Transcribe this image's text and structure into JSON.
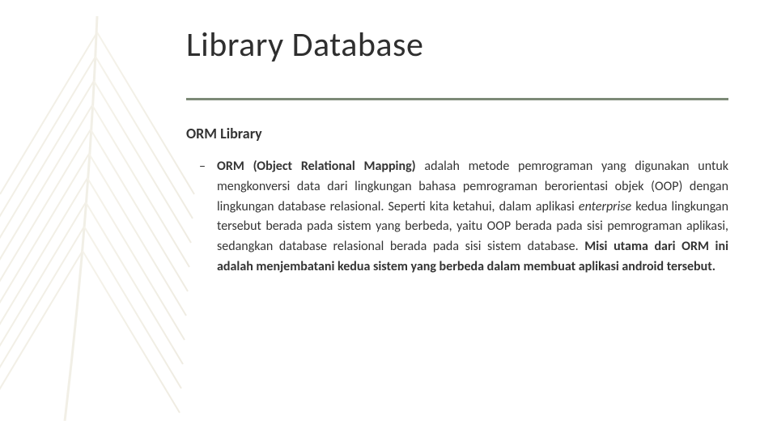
{
  "slide": {
    "title": "Library Database",
    "sub_heading": "ORM Library",
    "bullet": {
      "lead_bold": "ORM (Object Relational Mapping)",
      "text1": " adalah metode pemrograman yang digunakan untuk mengkonversi data dari lingkungan bahasa pemrograman berorientasi objek (OOP) dengan lingkungan database relasional. Seperti kita ketahui, dalam aplikasi ",
      "italic1": "enterprise",
      "text2": " kedua lingkungan tersebut berada pada sistem yang berbeda, yaitu OOP berada pada sisi pemrograman aplikasi, sedangkan database relasional berada pada sisi sistem database. ",
      "tail_bold": "Misi utama dari ORM ini adalah menjembatani kedua sistem yang berbeda dalam membuat aplikasi android tersebut."
    }
  }
}
